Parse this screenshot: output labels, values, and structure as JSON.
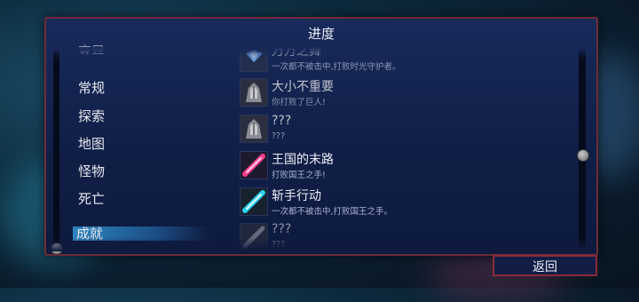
{
  "panel": {
    "title": "进度"
  },
  "categories": [
    {
      "label": "变异",
      "selected": false
    },
    {
      "label": "常规",
      "selected": false
    },
    {
      "label": "探索",
      "selected": false
    },
    {
      "label": "地图",
      "selected": false
    },
    {
      "label": "怪物",
      "selected": false
    },
    {
      "label": "死亡",
      "selected": false
    },
    {
      "label": "成就",
      "selected": true
    }
  ],
  "achievements": [
    {
      "name": "万万之舞",
      "description": "一次都不被击中,打败时光守护者。",
      "icon": "blue-crystal-icon",
      "locked": true
    },
    {
      "name": "大小不重要",
      "description": "你打败了巨人!",
      "icon": "giant-helmet-icon",
      "locked": true
    },
    {
      "name": "???",
      "description": "???",
      "icon": "giant-helmet-icon",
      "locked": true
    },
    {
      "name": "王国的末路",
      "description": "打败国王之手!",
      "icon": "pink-sword-icon",
      "locked": false
    },
    {
      "name": "斩手行动",
      "description": "一次都不被击中,打败国王之手。",
      "icon": "cyan-sword-icon",
      "locked": false
    },
    {
      "name": "???",
      "description": "???",
      "icon": "grey-sword-icon",
      "locked": true
    }
  ],
  "back_button": {
    "label": "返回"
  },
  "colors": {
    "frame": "#6e2a36",
    "panel": "#182a5a",
    "selection": "#2c84c0"
  }
}
